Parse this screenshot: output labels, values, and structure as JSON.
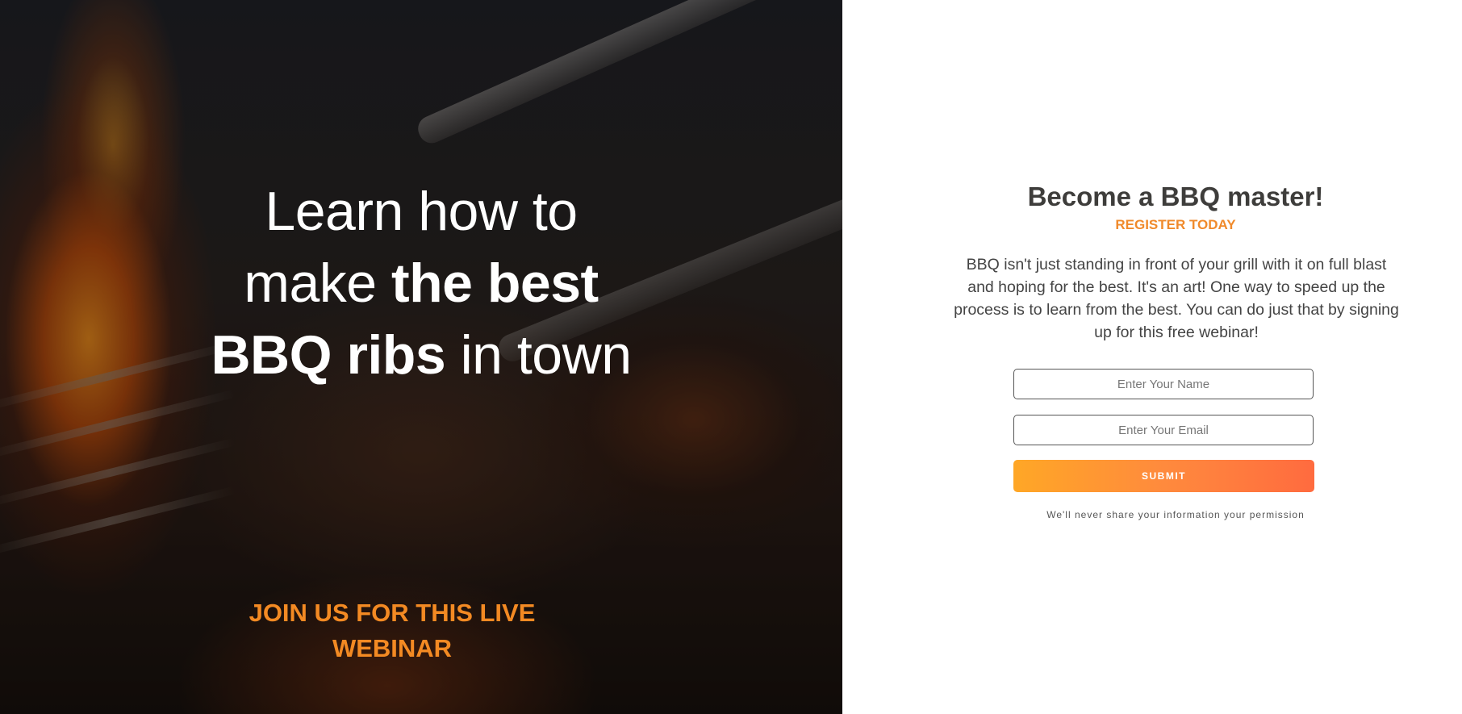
{
  "hero": {
    "title_line1": "Learn how to",
    "title_line2_regular": "make ",
    "title_line2_bold": "the best",
    "title_line3_bold": "BBQ ribs",
    "title_line3_regular": " in town",
    "cta_line1": "JOIN US FOR THIS LIVE",
    "cta_line2": "WEBINAR"
  },
  "registration": {
    "title": "Become a BBQ master!",
    "subtitle": "REGISTER TODAY",
    "body": "BBQ isn't just standing in front of your grill with it on full blast and hoping for the best. It's an art! One way to speed up the process is to learn from the best. You can do just that by signing up for this free webinar!",
    "name_placeholder": "Enter Your Name",
    "email_placeholder": "Enter Your Email",
    "submit_label": "SUBMIT",
    "privacy_note": "We'll never share your information your permission"
  },
  "colors": {
    "accent_orange": "#f38a23",
    "button_gradient_start": "#ffa726",
    "button_gradient_end": "#ff6b3f",
    "heading_text": "#3e3d3b"
  }
}
